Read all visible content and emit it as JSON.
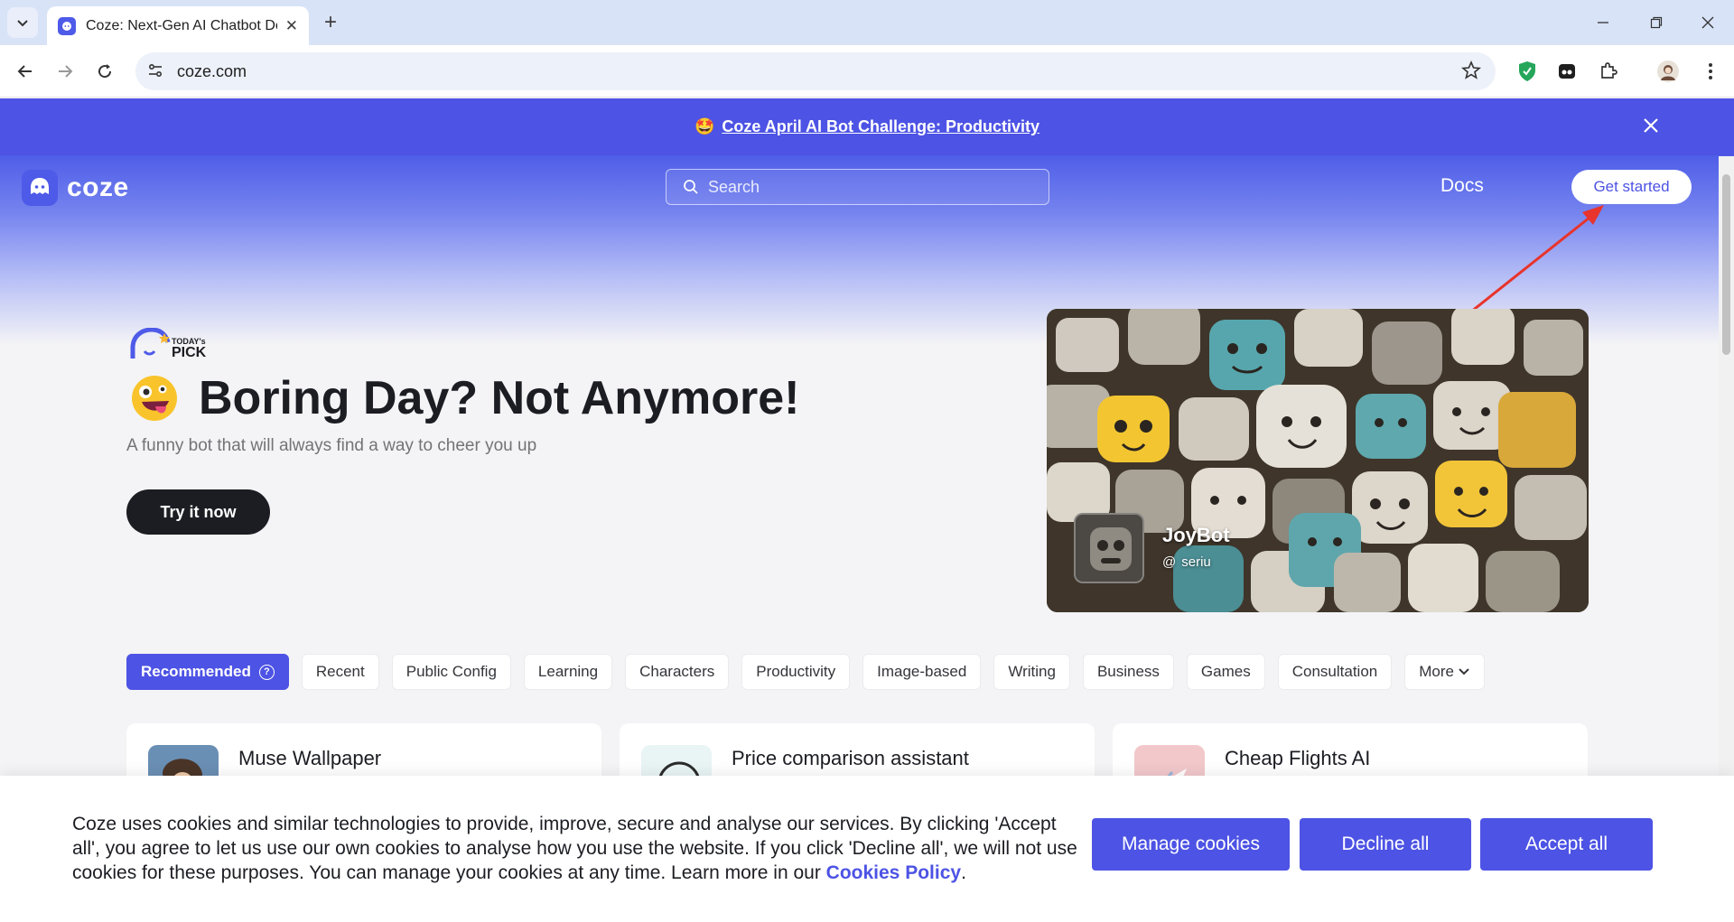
{
  "browser": {
    "tab_title": "Coze: Next-Gen AI Chatbot Developer",
    "url": "coze.com"
  },
  "promo": {
    "text": "Coze April AI Bot Challenge: Productivity"
  },
  "header": {
    "logo_text": "coze",
    "search_placeholder": "Search",
    "docs_label": "Docs",
    "get_started_label": "Get started"
  },
  "hero": {
    "badge_top": "TODAY's",
    "badge_bottom": "PICK",
    "title": "Boring Day? Not Anymore!",
    "subtitle": "A funny bot that will always find a way to cheer you up",
    "cta_label": "Try it now",
    "bot_name": "JoyBot",
    "bot_author": "seriu"
  },
  "categories": [
    {
      "label": "Recommended",
      "active": true
    },
    {
      "label": "Recent"
    },
    {
      "label": "Public Config"
    },
    {
      "label": "Learning"
    },
    {
      "label": "Characters"
    },
    {
      "label": "Productivity"
    },
    {
      "label": "Image-based"
    },
    {
      "label": "Writing"
    },
    {
      "label": "Business"
    },
    {
      "label": "Games"
    },
    {
      "label": "Consultation"
    },
    {
      "label": "More"
    }
  ],
  "bots": [
    {
      "title": "Muse Wallpaper"
    },
    {
      "title": "Price comparison assistant"
    },
    {
      "title": "Cheap Flights AI"
    }
  ],
  "cookie": {
    "text": "Coze uses cookies and similar technologies to provide, improve, secure and analyse our services. By clicking 'Accept all', you agree to let us use our own cookies to analyse how you use the website. If you click 'Decline all', we will not use cookies for these purposes. You can manage your cookies at any time. Learn more in our",
    "policy_link": "Cookies Policy",
    "manage_label": "Manage cookies",
    "decline_label": "Decline all",
    "accept_label": "Accept all"
  },
  "colors": {
    "brand": "#4d53e4",
    "dark_button": "#1c1d23"
  }
}
